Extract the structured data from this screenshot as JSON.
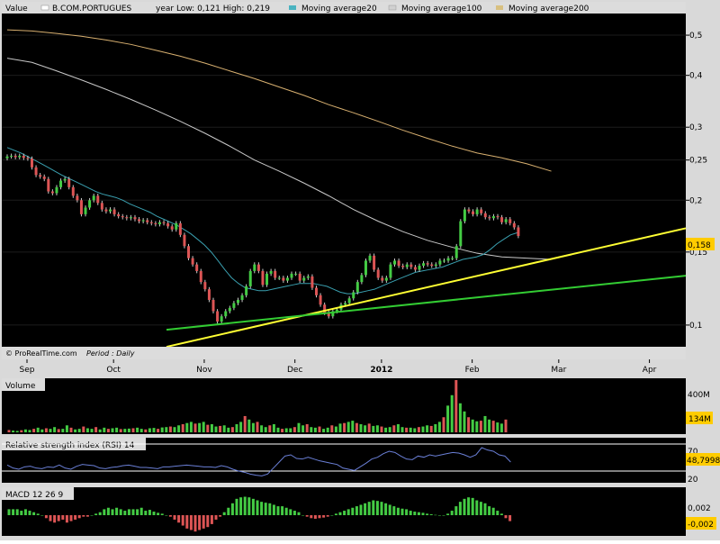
{
  "header": {
    "value_label": "Value",
    "symbol": "B.COM.PORTUGUES",
    "year_range": "year Low: 0,121 High: 0,219",
    "legend": [
      {
        "label": "Moving average20",
        "color": "#4ab3c0"
      },
      {
        "label": "Moving average100",
        "color": "#d0d0d0"
      },
      {
        "label": "Moving average200",
        "color": "#d8c080"
      }
    ]
  },
  "footer": {
    "source": "© ProRealTime.com",
    "period_label": "Period",
    "period_value": ": Daily"
  },
  "price_axis": {
    "ticks": [
      {
        "label": "0,5",
        "value": 0.5
      },
      {
        "label": "0,4",
        "value": 0.4
      },
      {
        "label": "0,3",
        "value": 0.3
      },
      {
        "label": "0,25",
        "value": 0.25
      },
      {
        "label": "0,2",
        "value": 0.2
      },
      {
        "label": "0,15",
        "value": 0.15
      },
      {
        "label": "0,1",
        "value": 0.1
      }
    ],
    "current_label": "0,158",
    "current_value": 0.158
  },
  "x_axis": {
    "ticks": [
      {
        "label": "Sep",
        "index": 0,
        "bold": false
      },
      {
        "label": "Oct",
        "index": 21,
        "bold": false
      },
      {
        "label": "Nov",
        "index": 43,
        "bold": false
      },
      {
        "label": "Dec",
        "index": 65,
        "bold": false
      },
      {
        "label": "2012",
        "index": 86,
        "bold": true
      },
      {
        "label": "Feb",
        "index": 108,
        "bold": false
      },
      {
        "label": "Mar",
        "index": 129,
        "bold": false
      },
      {
        "label": "Apr",
        "index": 151,
        "bold": false
      }
    ]
  },
  "volume_panel": {
    "title": "Volume",
    "tick_label": "400M",
    "current_label": "134M"
  },
  "rsi_panel": {
    "title": "Relative strength index (RSI) 14",
    "tick_70": "70",
    "tick_20": "20",
    "current_label": "48,7998"
  },
  "macd_panel": {
    "title": "MACD 12 26 9",
    "tick_label": "0,002",
    "current_label": "-0,002"
  },
  "chart_data": {
    "type": "candlestick",
    "log_scale": true,
    "ylim": [
      0.09,
      0.55
    ],
    "x_range": [
      0,
      165
    ],
    "closes": [
      0.255,
      0.256,
      0.254,
      0.256,
      0.253,
      0.252,
      0.24,
      0.23,
      0.228,
      0.225,
      0.21,
      0.208,
      0.215,
      0.223,
      0.225,
      0.215,
      0.205,
      0.2,
      0.185,
      0.192,
      0.2,
      0.205,
      0.197,
      0.19,
      0.188,
      0.19,
      0.185,
      0.183,
      0.182,
      0.181,
      0.182,
      0.18,
      0.178,
      0.179,
      0.177,
      0.176,
      0.175,
      0.177,
      0.176,
      0.173,
      0.17,
      0.176,
      0.165,
      0.155,
      0.145,
      0.14,
      0.135,
      0.127,
      0.122,
      0.115,
      0.108,
      0.102,
      0.105,
      0.108,
      0.11,
      0.113,
      0.115,
      0.118,
      0.124,
      0.135,
      0.14,
      0.135,
      0.125,
      0.133,
      0.135,
      0.13,
      0.13,
      0.128,
      0.13,
      0.133,
      0.133,
      0.128,
      0.13,
      0.131,
      0.123,
      0.118,
      0.112,
      0.107,
      0.105,
      0.108,
      0.109,
      0.112,
      0.113,
      0.116,
      0.12,
      0.127,
      0.132,
      0.143,
      0.147,
      0.136,
      0.13,
      0.128,
      0.13,
      0.14,
      0.143,
      0.139,
      0.138,
      0.14,
      0.138,
      0.136,
      0.139,
      0.141,
      0.14,
      0.139,
      0.14,
      0.143,
      0.143,
      0.145,
      0.145,
      0.155,
      0.178,
      0.19,
      0.188,
      0.185,
      0.19,
      0.186,
      0.182,
      0.181,
      0.183,
      0.182,
      0.177,
      0.18,
      0.176,
      0.172,
      0.164
    ],
    "ma20": [
      0.268,
      0.264,
      0.26,
      0.255,
      0.25,
      0.245,
      0.24,
      0.235,
      0.23,
      0.226,
      0.222,
      0.218,
      0.214,
      0.21,
      0.207,
      0.205,
      0.203,
      0.2,
      0.196,
      0.193,
      0.19,
      0.187,
      0.183,
      0.18,
      0.177,
      0.174,
      0.17,
      0.166,
      0.161,
      0.156,
      0.15,
      0.143,
      0.136,
      0.13,
      0.126,
      0.123,
      0.122,
      0.121,
      0.121,
      0.122,
      0.123,
      0.124,
      0.125,
      0.126,
      0.126,
      0.126,
      0.125,
      0.124,
      0.122,
      0.12,
      0.119,
      0.119,
      0.12,
      0.121,
      0.122,
      0.124,
      0.126,
      0.128,
      0.13,
      0.132,
      0.134,
      0.135,
      0.136,
      0.137,
      0.138,
      0.14,
      0.142,
      0.144,
      0.145,
      0.146,
      0.148,
      0.152,
      0.157,
      0.161,
      0.165,
      0.167
    ],
    "ma20_start": 0,
    "ma100": [
      0.44,
      0.43,
      0.41,
      0.39,
      0.37,
      0.35,
      0.33,
      0.31,
      0.29,
      0.27,
      0.25,
      0.235,
      0.22,
      0.205,
      0.19,
      0.178,
      0.168,
      0.16,
      0.154,
      0.149,
      0.146,
      0.145,
      0.144
    ],
    "ma100_step": 6,
    "ma200": [
      0.515,
      0.512,
      0.505,
      0.497,
      0.487,
      0.475,
      0.46,
      0.445,
      0.428,
      0.41,
      0.393,
      0.375,
      0.358,
      0.34,
      0.325,
      0.31,
      0.295,
      0.282,
      0.27,
      0.26,
      0.253,
      0.245,
      0.235
    ],
    "ma200_step": 6,
    "trendlines": [
      {
        "color": "#ffff33",
        "p1": [
          72,
          0.1055
        ],
        "p2": [
          145,
          0.1545
        ]
      },
      {
        "color": "#33cc33",
        "p1": [
          72,
          0.1055
        ],
        "p2": [
          145,
          0.1255
        ]
      }
    ],
    "volume": [
      20,
      15,
      12,
      18,
      25,
      20,
      30,
      40,
      25,
      35,
      30,
      45,
      28,
      30,
      60,
      40,
      25,
      30,
      50,
      35,
      30,
      45,
      25,
      40,
      30,
      35,
      40,
      28,
      30,
      32,
      35,
      40,
      30,
      25,
      35,
      38,
      30,
      42,
      45,
      50,
      45,
      60,
      70,
      80,
      90,
      75,
      80,
      90,
      65,
      70,
      50,
      55,
      60,
      40,
      45,
      70,
      90,
      140,
      110,
      80,
      90,
      60,
      45,
      60,
      70,
      40,
      30,
      35,
      35,
      45,
      80,
      60,
      70,
      45,
      40,
      50,
      30,
      40,
      60,
      50,
      75,
      80,
      90,
      100,
      80,
      70,
      60,
      75,
      55,
      60,
      50,
      40,
      45,
      60,
      70,
      45,
      40,
      40,
      35,
      45,
      50,
      60,
      55,
      70,
      90,
      130,
      230,
      320,
      450,
      250,
      180,
      130,
      110,
      95,
      100,
      140,
      110,
      100,
      85,
      75,
      110
    ],
    "rsi": [
      45,
      40,
      38,
      42,
      43,
      40,
      39,
      42,
      41,
      45,
      40,
      38,
      43,
      46,
      45,
      44,
      40,
      39,
      41,
      42,
      44,
      45,
      43,
      41,
      41,
      40,
      39,
      42,
      42,
      43,
      44,
      45,
      44,
      43,
      42,
      42,
      41,
      44,
      42,
      38,
      35,
      33,
      30,
      28,
      27,
      30,
      40,
      50,
      60,
      62,
      56,
      55,
      58,
      55,
      52,
      50,
      48,
      46,
      40,
      38,
      36,
      42,
      48,
      55,
      58,
      64,
      68,
      66,
      60,
      55,
      54,
      60,
      58,
      62,
      60,
      62,
      64,
      66,
      65,
      62,
      58,
      62,
      74,
      70,
      68,
      62,
      60,
      50
    ],
    "macd": [
      0.002,
      0.002,
      0.002,
      0.0015,
      0.002,
      0.0015,
      0.001,
      0.0005,
      0,
      -0.001,
      -0.002,
      -0.0025,
      -0.002,
      -0.0015,
      -0.0025,
      -0.002,
      -0.0015,
      -0.001,
      -0.0005,
      -0.0005,
      0,
      0.0005,
      0.001,
      0.002,
      0.0025,
      0.002,
      0.0025,
      0.002,
      0.0015,
      0.002,
      0.002,
      0.002,
      0.0025,
      0.0015,
      0.0018,
      0.0012,
      0.0008,
      0.0005,
      0,
      -0.0005,
      -0.0015,
      -0.0025,
      -0.0035,
      -0.0045,
      -0.005,
      -0.0055,
      -0.005,
      -0.0045,
      -0.004,
      -0.003,
      -0.0015,
      -0.0005,
      0.001,
      0.0025,
      0.004,
      0.0055,
      0.006,
      0.0062,
      0.006,
      0.0055,
      0.005,
      0.0045,
      0.0042,
      0.004,
      0.0035,
      0.003,
      0.003,
      0.0025,
      0.002,
      0.0015,
      0.001,
      0,
      -0.0005,
      -0.001,
      -0.0012,
      -0.001,
      -0.0008,
      -0.0005,
      0,
      0.0005,
      0.001,
      0.0015,
      0.002,
      0.0025,
      0.003,
      0.0035,
      0.004,
      0.0045,
      0.005,
      0.0048,
      0.0045,
      0.004,
      0.0035,
      0.003,
      0.0025,
      0.0022,
      0.002,
      0.0015,
      0.0012,
      0.001,
      0.0008,
      0.0005,
      0.0003,
      0.0001,
      0,
      0,
      0.0005,
      0.0015,
      0.003,
      0.0045,
      0.0055,
      0.006,
      0.0058,
      0.005,
      0.0045,
      0.004,
      0.003,
      0.0025,
      0.0015,
      0.0005,
      -0.001,
      -0.002
    ]
  }
}
